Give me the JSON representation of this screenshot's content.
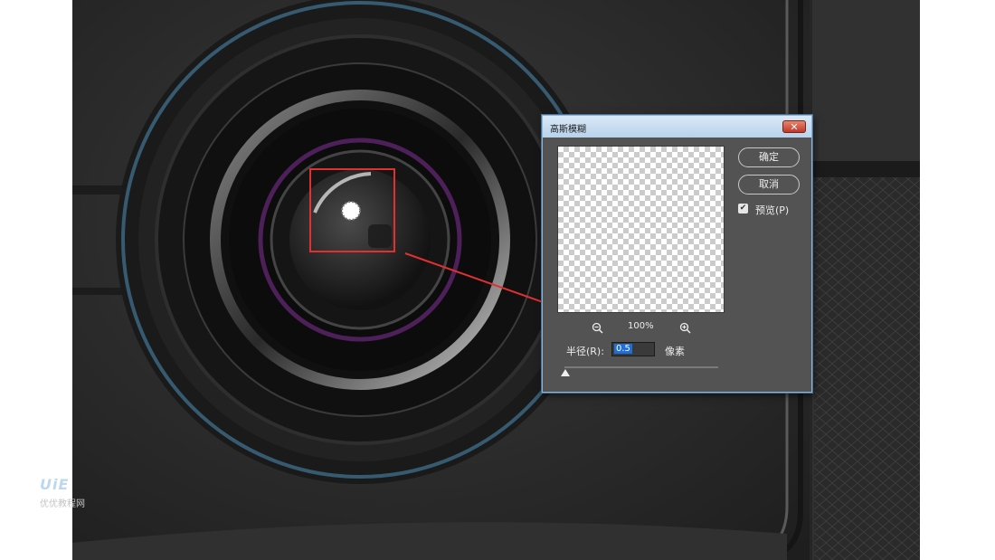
{
  "dialog": {
    "title": "高斯模糊",
    "close_label": "✕",
    "ok_label": "确定",
    "cancel_label": "取消",
    "preview_label": "预览(P)",
    "preview_checked": true,
    "zoom_level": "100%",
    "radius_label": "半径(R):",
    "radius_value": "0.5",
    "radius_unit": "像素"
  },
  "watermark": {
    "logo": "UiE",
    "text": "优优教程网"
  },
  "colors": {
    "highlight_box": "#e03030",
    "arrow": "#e03030",
    "lens_rim_blue": "#3d6c86",
    "lens_purple": "#6a2a7a",
    "dialog_bg": "#535353",
    "selection_blue": "#1f6fd6"
  },
  "icons": {
    "zoom_out": "zoom-out-icon",
    "zoom_in": "zoom-in-icon",
    "close": "close-icon",
    "checkbox": "checkmark-icon"
  }
}
